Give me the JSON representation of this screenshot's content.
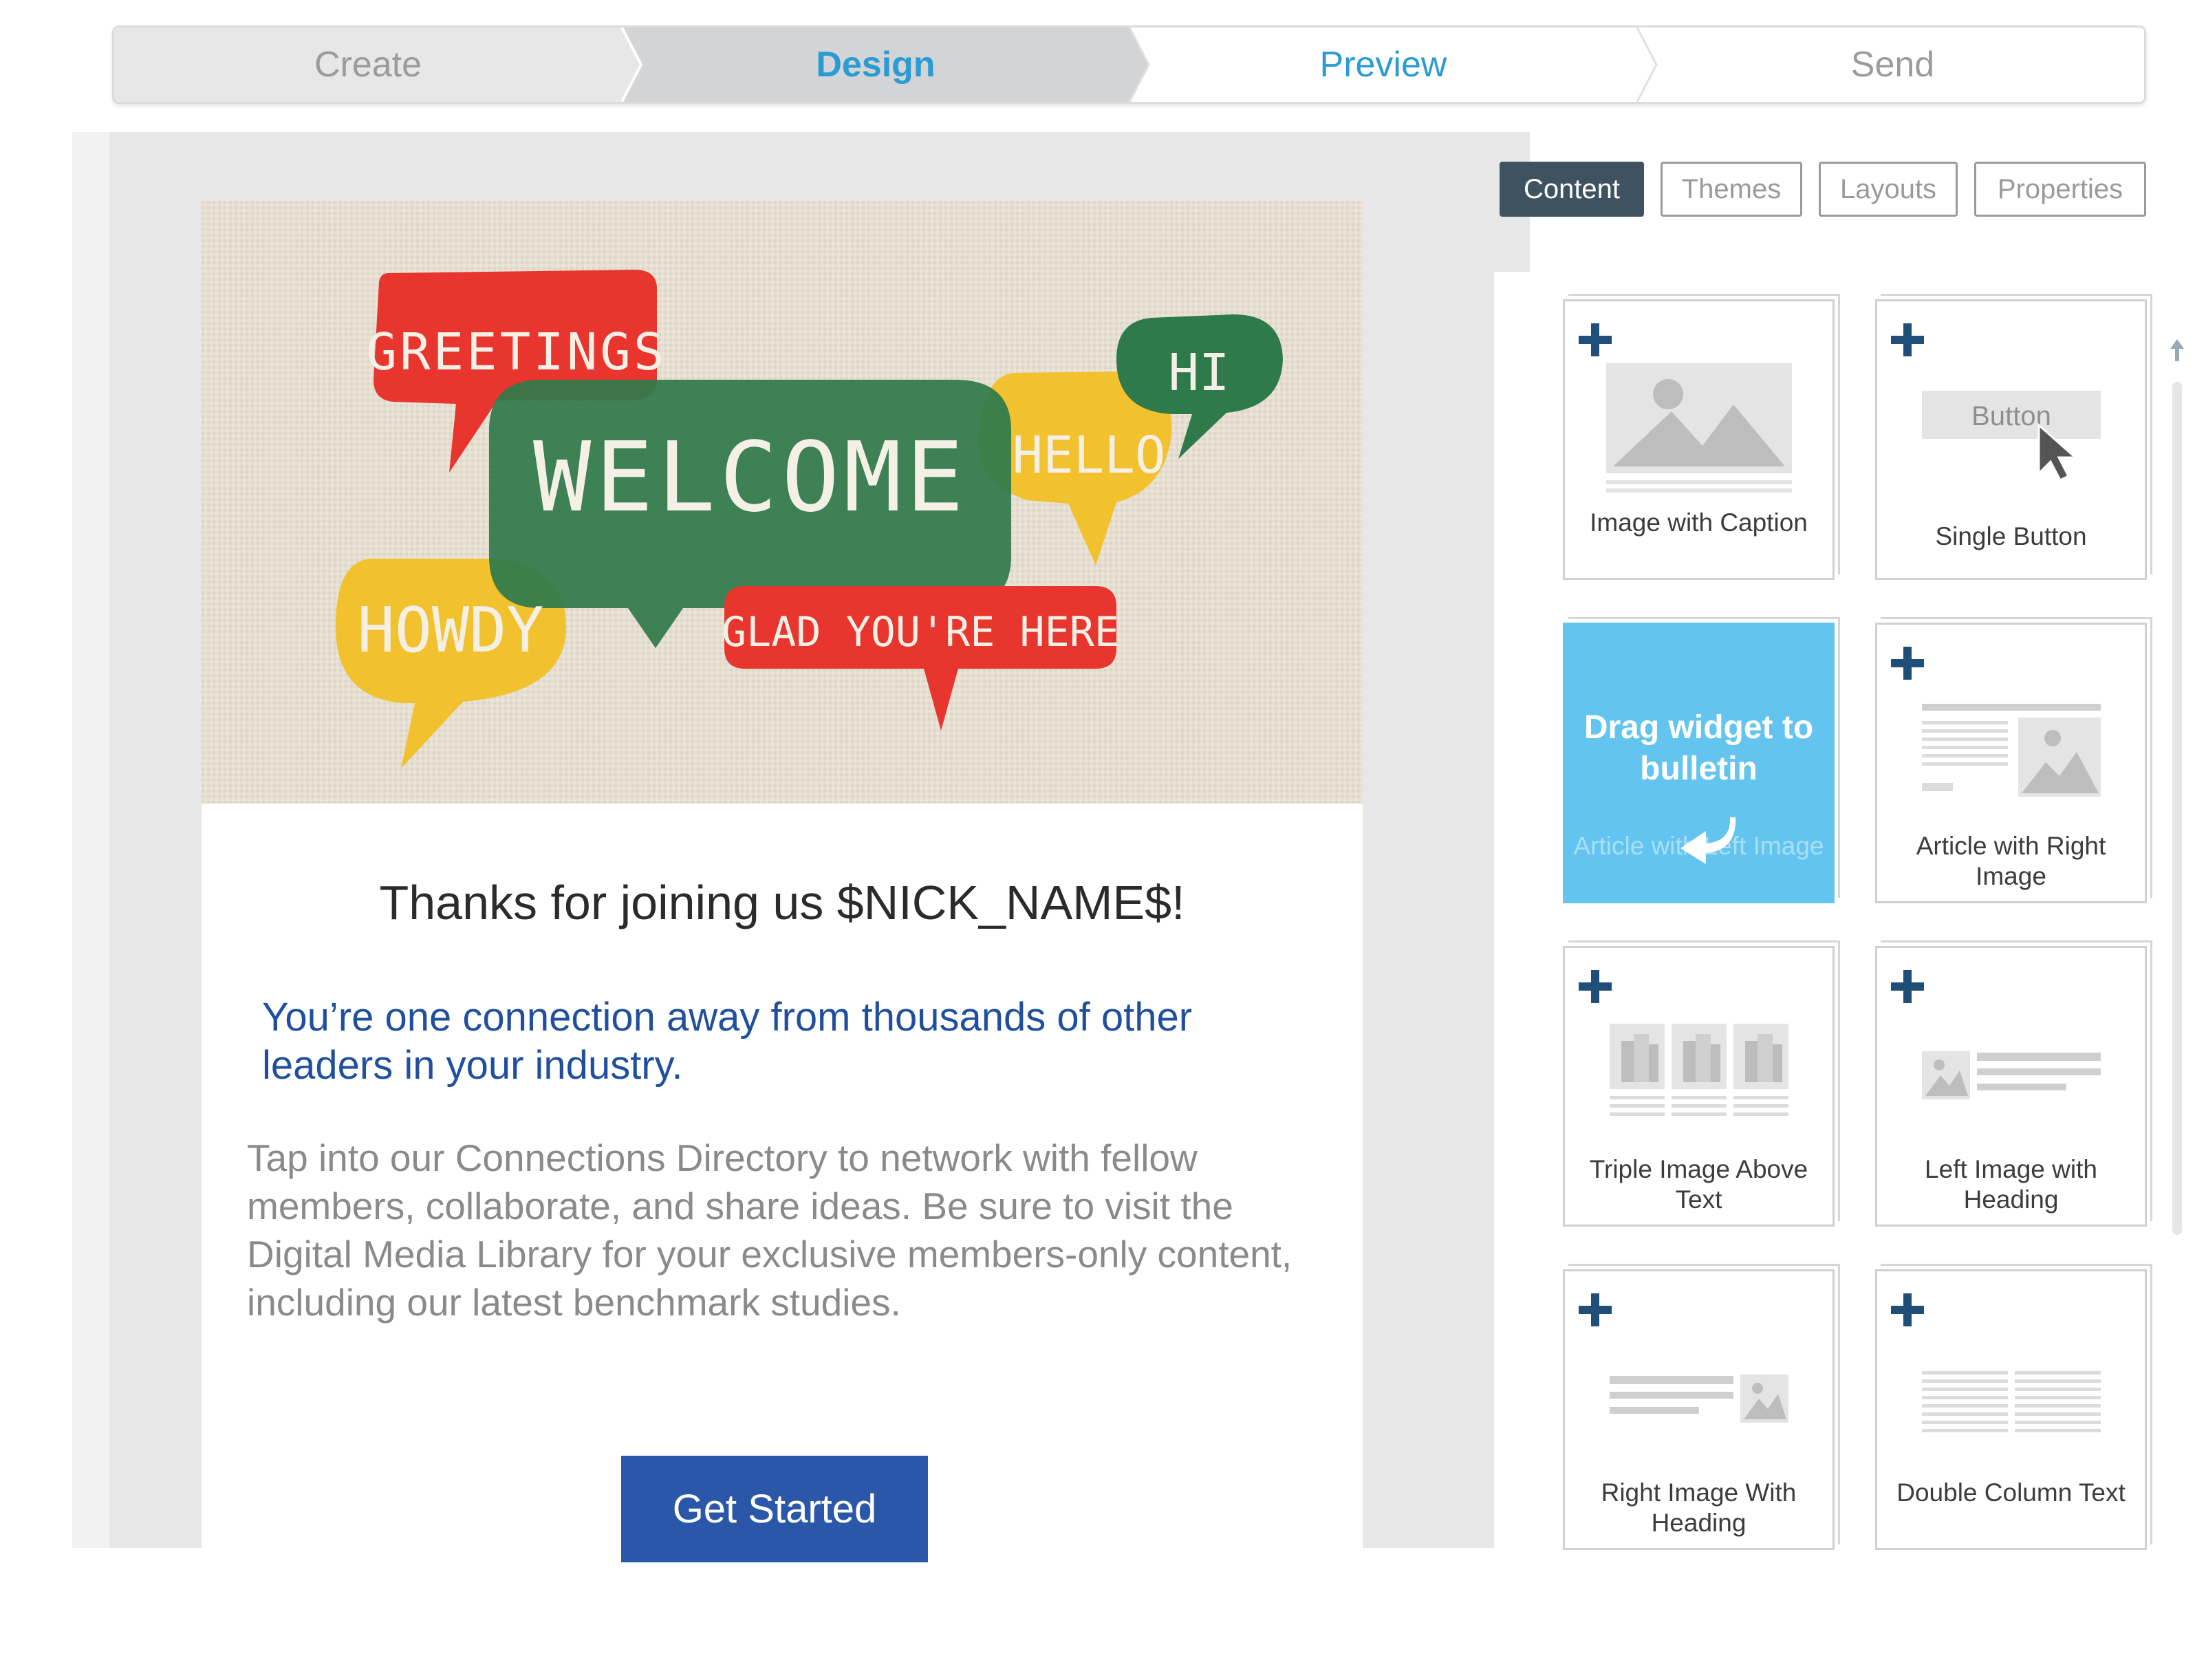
{
  "wizard": {
    "steps": [
      {
        "label": "Create",
        "state": "done"
      },
      {
        "label": "Design",
        "state": "current"
      },
      {
        "label": "Preview",
        "state": "next"
      },
      {
        "label": "Send",
        "state": "pending"
      }
    ]
  },
  "email": {
    "hero_words": {
      "greetings": "GREETINGS",
      "welcome": "WELCOME",
      "hello": "HELLO",
      "hi": "HI",
      "howdy": "HOWDY",
      "glad": "GLAD YOU'RE HERE"
    },
    "heading": "Thanks for joining us $NICK_NAME$!",
    "subheading": "You’re one connection away from thousands of other leaders in your industry.",
    "body": "Tap into our Connections Directory to network with fellow members, collaborate, and share ideas. Be sure to visit the Digital Media Library for your exclusive members-only content, including our latest benchmark studies.",
    "cta_label": "Get Started"
  },
  "panel": {
    "tabs": [
      "Content",
      "Themes",
      "Layouts",
      "Properties"
    ],
    "active_tab": "Content",
    "widgets": [
      {
        "label": "Image with Caption",
        "icon": "image-caption-icon"
      },
      {
        "label": "Single Button",
        "icon": "button-icon",
        "thumb_text": "Button"
      },
      {
        "label": "Article with Left Image",
        "icon": "article-left-image-icon",
        "dragging": true,
        "drag_hint": "Drag widget to bulletin"
      },
      {
        "label": "Article with Right Image",
        "icon": "article-right-image-icon"
      },
      {
        "label": "Triple Image Above Text",
        "icon": "triple-image-icon"
      },
      {
        "label": "Left Image with Heading",
        "icon": "left-image-heading-icon"
      },
      {
        "label": "Right Image With Heading",
        "icon": "right-image-heading-icon"
      },
      {
        "label": "Double Column Text",
        "icon": "double-column-icon"
      }
    ]
  },
  "colors": {
    "accent": "#2a9bd3",
    "cta": "#2b57a8",
    "plus": "#1f4f78",
    "drag": "#63c5ef",
    "active_tab": "#3f5260"
  }
}
